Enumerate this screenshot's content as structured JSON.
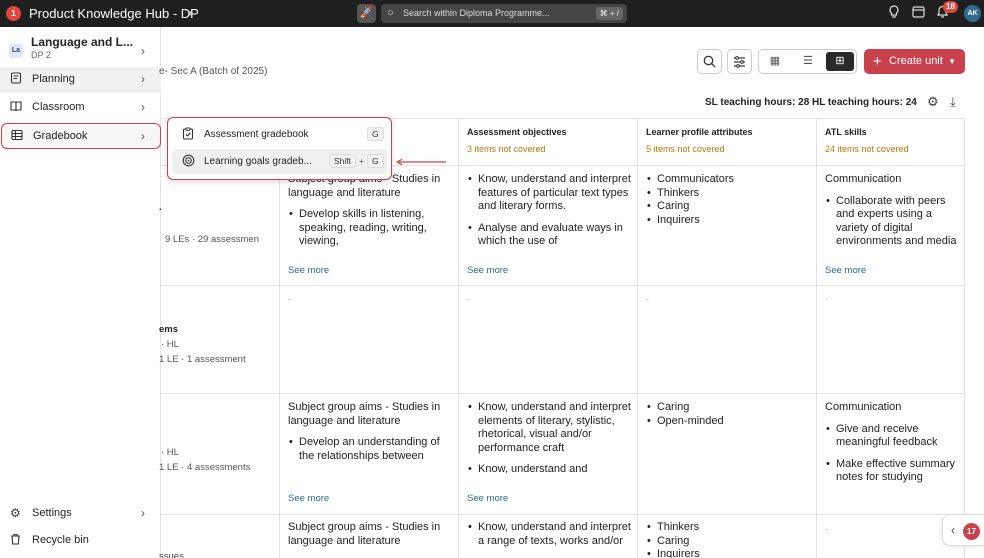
{
  "topbar": {
    "logo_badge": "1",
    "app_title": "Product Knowledge Hub - DP",
    "search_placeholder": "Search within Diploma Programme...",
    "search_shortcut": "⌘ + /",
    "notification_count": "18",
    "avatar_initials": "AK"
  },
  "sidebar": {
    "course": {
      "badge": "La",
      "name": "Language and L...",
      "grade": "DP 2"
    },
    "items": [
      {
        "label": "Planning",
        "icon": "document-icon"
      },
      {
        "label": "Classroom",
        "icon": "book-icon"
      },
      {
        "label": "Gradebook",
        "icon": "table-icon"
      }
    ],
    "bottom_items": [
      {
        "label": "Settings",
        "icon": "gear-icon"
      },
      {
        "label": "Recycle bin",
        "icon": "trash-icon"
      }
    ]
  },
  "gradebook_menu": {
    "items": [
      {
        "label": "Assessment gradebook",
        "shortcut": [
          "G"
        ]
      },
      {
        "label": "Learning goals gradeb...",
        "shortcut": [
          "Shift",
          "G"
        ]
      }
    ],
    "plus": "+"
  },
  "main": {
    "breadcrumb": "e- Sec A (Batch of 2025)",
    "create_button": "Create unit",
    "sl_hours": "SL teaching hours: 28",
    "hl_hours": "HL teaching hours: 24",
    "columns": [
      {
        "header": "Assessment objectives",
        "status": "3 items not covered"
      },
      {
        "header": "Learner profile attributes",
        "status": "5 items not covered"
      },
      {
        "header": "ATL skills",
        "status": "24 items not covered"
      }
    ],
    "see_more": "See more",
    "dash": "-",
    "row1": {
      "meta": "9 LEs · 29 assessmen",
      "aims_title": "Subject group aims - Studies in language and literature",
      "aims_bullets": [
        "Develop skills in listening, speaking, reading, writing, viewing,"
      ],
      "objectives": [
        "Know, understand and interpret features of particular text types and literary forms.",
        "Analyse and evaluate ways in which the use of"
      ],
      "profiles": [
        "Communicators",
        "Thinkers",
        "Caring",
        "Inquirers"
      ],
      "atl_title": "Communication",
      "atl_bullets": [
        "Collaborate with peers and experts using a variety of digital environments and media"
      ]
    },
    "row2": {
      "title_fragment": "ems",
      "level": "· HL",
      "meta": "1 LE · 1 assessment"
    },
    "row3": {
      "level": "· HL",
      "meta": "1 LE · 4 assessments",
      "aims_title": "Subject group aims - Studies in language and literature",
      "aims_bullets": [
        "Develop an understanding of the relationships between"
      ],
      "objectives": [
        "Know, understand and interpret elements of literary, stylistic, rhetorical, visual and/or performance craft",
        "Know, understand and"
      ],
      "profiles": [
        "Caring",
        "Open-minded"
      ],
      "atl_title": "Communication",
      "atl_bullets": [
        "Give and receive meaningful feedback",
        "Make effective summary notes for studying"
      ]
    },
    "row4": {
      "title_fragment": "ssues",
      "aims_title": "Subject group aims - Studies in language and literature",
      "objectives": [
        "Know, understand and interpret a range of texts, works and/or"
      ],
      "profiles": [
        "Thinkers",
        "Caring",
        "Inquirers"
      ]
    }
  },
  "floating_pill": {
    "count": "17"
  },
  "colors": {
    "accent": "#c9414c",
    "warning": "#c0770e",
    "link": "#2a6b8f",
    "topbar": "#1f1f1f"
  }
}
